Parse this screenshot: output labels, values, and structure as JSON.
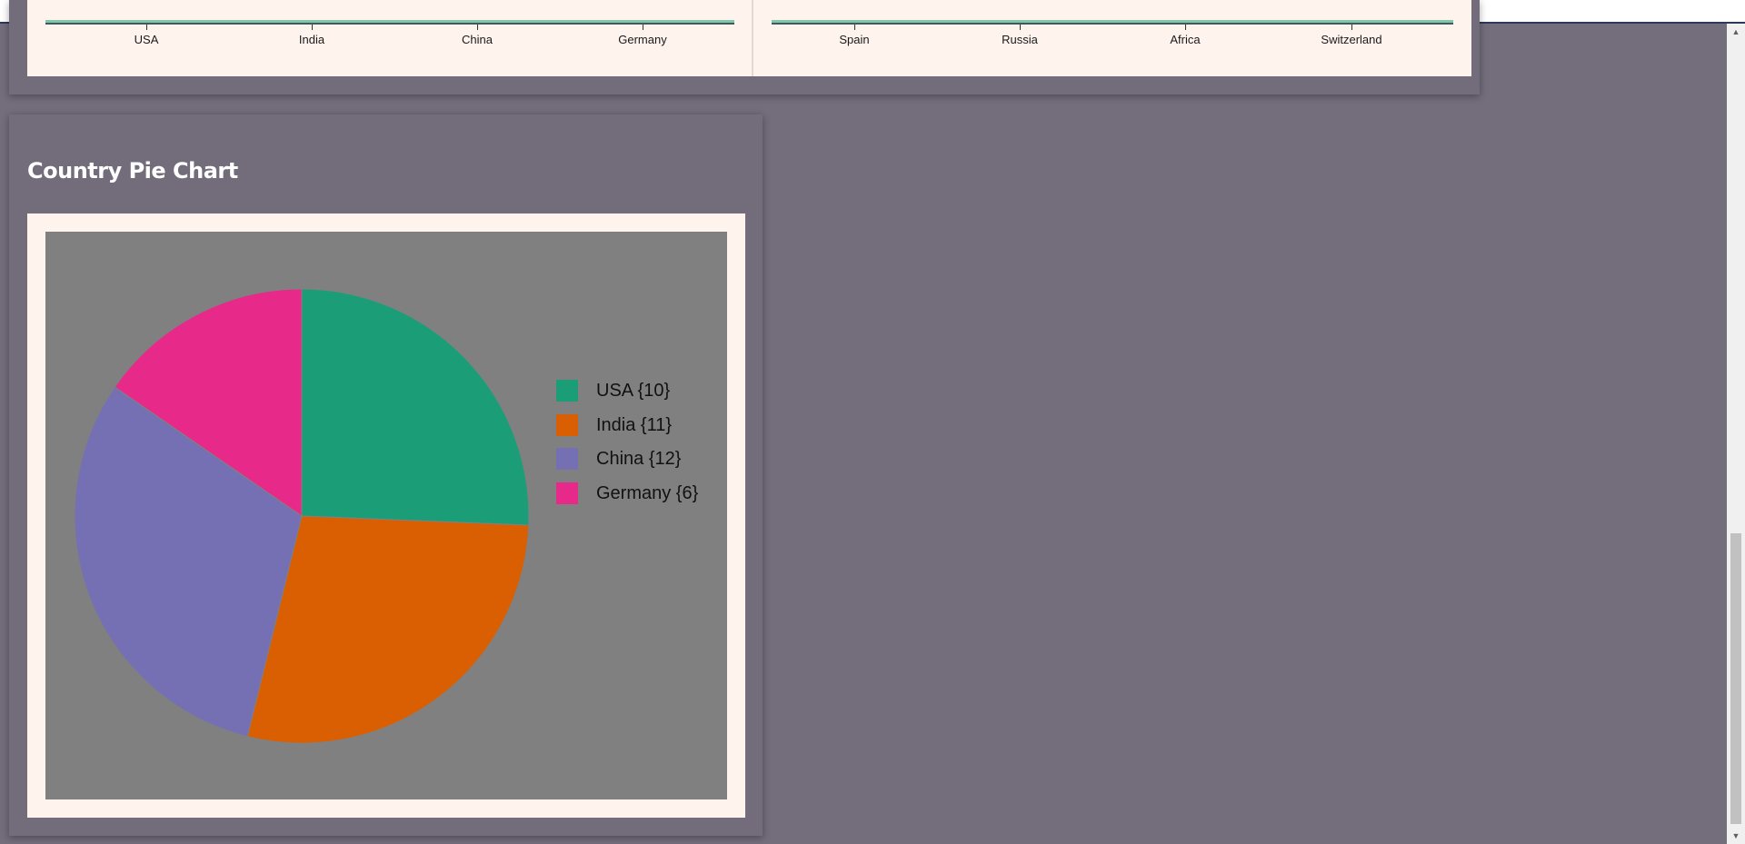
{
  "bar_chart": {
    "left_categories": [
      "USA",
      "India",
      "China",
      "Germany"
    ],
    "right_categories": [
      "Spain",
      "Russia",
      "Africa",
      "Switzerland"
    ]
  },
  "pie_section": {
    "title": "Country Pie Chart"
  },
  "chart_data": {
    "type": "pie",
    "title": "Country Pie Chart",
    "categories": [
      "USA",
      "India",
      "China",
      "Germany"
    ],
    "values": [
      10,
      11,
      12,
      6
    ],
    "legend_labels": [
      "USA {10}",
      "India {11}",
      "China {12}",
      "Germany {6}"
    ],
    "colors": [
      "#1b9e77",
      "#d95f02",
      "#7570b3",
      "#e7298a"
    ],
    "background": "#808080",
    "legend": "right"
  },
  "scrollbar": {
    "up_icon": "▲",
    "down_icon": "▼"
  }
}
